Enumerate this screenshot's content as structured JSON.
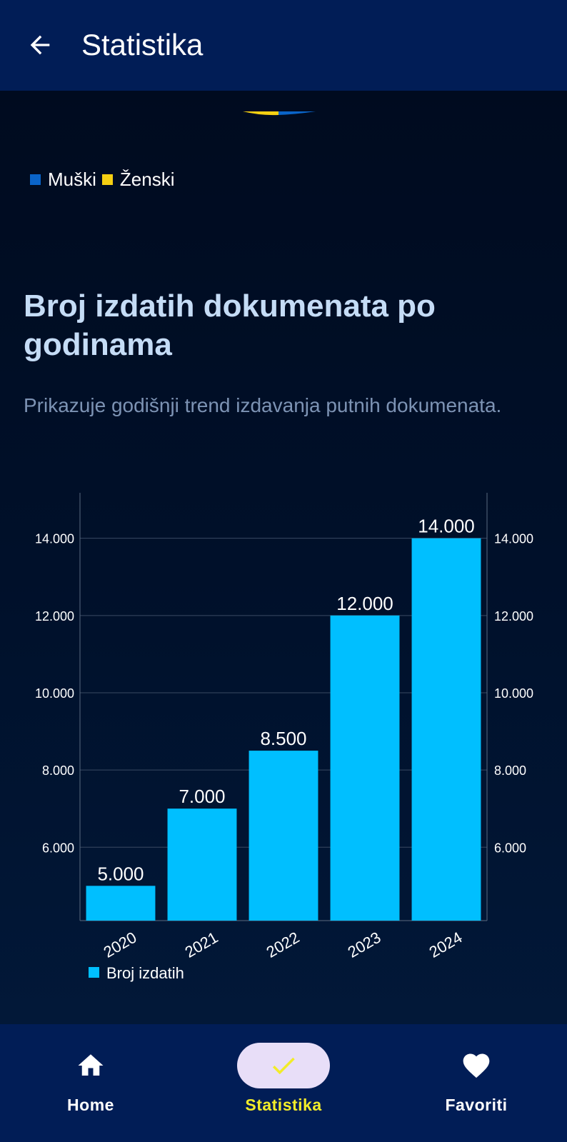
{
  "appbar": {
    "title": "Statistika"
  },
  "gender_legend": [
    {
      "label": "Muški",
      "color": "#0a64c8"
    },
    {
      "label": "Ženski",
      "color": "#f5cf12"
    }
  ],
  "section": {
    "title": "Broj izdatih dokumenata po godinama",
    "description": "Prikazuje godišnji trend izdavanja putnih dokumenata."
  },
  "chart_data": {
    "type": "bar",
    "categories": [
      "2020",
      "2021",
      "2022",
      "2023",
      "2024"
    ],
    "series": [
      {
        "name": "Broj izdatih",
        "values": [
          5000,
          7000,
          8500,
          12000,
          14000
        ],
        "color": "#00bfff"
      }
    ],
    "value_labels": [
      "5.000",
      "7.000",
      "8.500",
      "12.000",
      "14.000"
    ],
    "y_ticks": [
      6000,
      8000,
      10000,
      12000,
      14000
    ],
    "y_tick_labels": [
      "6.000",
      "8.000",
      "10.000",
      "12.000",
      "14.000"
    ],
    "ylim": [
      4100,
      14900
    ],
    "dual_y_axis": true,
    "grid": true,
    "legend_position": "bottom-left",
    "x_label_rotation": "diagonal"
  },
  "bottom_nav": [
    {
      "label": "Home",
      "icon": "home-icon",
      "active": false
    },
    {
      "label": "Statistika",
      "icon": "check-icon",
      "active": true
    },
    {
      "label": "Favoriti",
      "icon": "heart-icon",
      "active": false
    }
  ],
  "colors": {
    "appbar": "#011d56",
    "accent_active": "#f2ec2a",
    "bar": "#00bfff"
  }
}
